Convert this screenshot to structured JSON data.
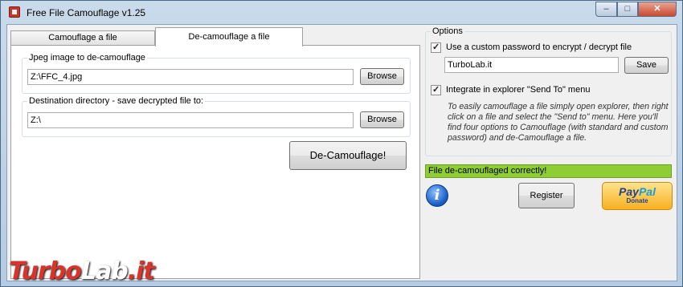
{
  "window": {
    "title": "Free File Camouflage v1.25",
    "min_glyph": "–",
    "max_glyph": "□",
    "close_glyph": "✕"
  },
  "tabs": [
    {
      "label": "Camouflage a file"
    },
    {
      "label": "De-camouflage a file"
    }
  ],
  "decamo": {
    "image_group_label": "Jpeg image to de-camouflage",
    "image_path": "Z:\\FFC_4.jpg",
    "browse_label": "Browse",
    "dest_group_label": "Destination directory - save decrypted file to:",
    "dest_path": "Z:\\",
    "browse2_label": "Browse",
    "run_label": "De-Camouflage!"
  },
  "options": {
    "legend": "Options",
    "custom_password_label": "Use a custom password to encrypt / decrypt file",
    "custom_password_checked": true,
    "password_value": "TurboLab.it",
    "save_label": "Save",
    "send_to_label": "Integrate in explorer \"Send To\" menu",
    "send_to_checked": true,
    "info_text": "To easily camouflage a file simply open explorer, then right click on a file and select the \"Send to\" menu. Here you'll find four options to Camouflage (with standard and custom password) and de-Camouflage a file."
  },
  "status": {
    "text": "File de-camouflaged correctly!",
    "color": "#8ecd34"
  },
  "footer": {
    "info_glyph": "i",
    "register_label": "Register",
    "paypal_pay": "Pay",
    "paypal_pal": "Pal",
    "paypal_donate": "Donate"
  },
  "watermark": {
    "turbo": "Turbo",
    "lab": "Lab",
    "suffix": ".it"
  }
}
